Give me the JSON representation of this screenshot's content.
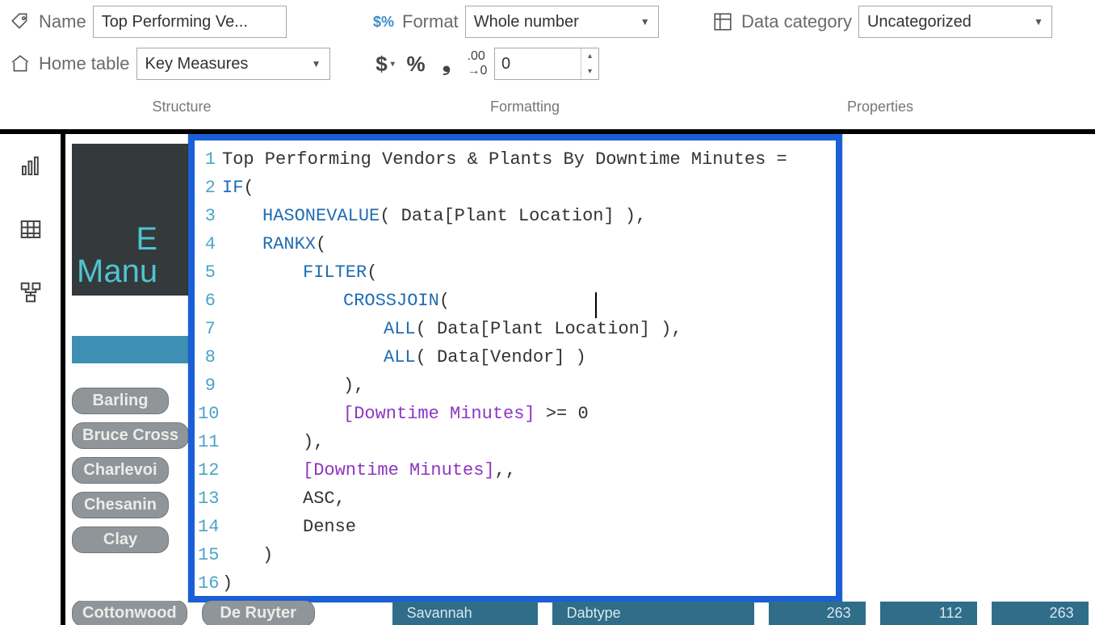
{
  "ribbon": {
    "name_label": "Name",
    "name_value": "Top Performing Ve...",
    "home_table_label": "Home table",
    "home_table_value": "Key Measures",
    "format_label": "Format",
    "format_value": "Whole number",
    "decimals_value": "0",
    "data_category_label": "Data category",
    "data_category_value": "Uncategorized",
    "structure_group": "Structure",
    "formatting_group": "Formatting",
    "properties_group": "Properties"
  },
  "slicers": {
    "items": [
      "Barling",
      "Bruce Cross",
      "Charlevoi",
      "Chesanin",
      "Clay"
    ],
    "bottom": [
      "Cottonwood",
      "De Ruyter"
    ]
  },
  "dark_text_line1": "E",
  "dark_text_line2": "Manu",
  "table_row": {
    "c0": "Savannah",
    "c1": "Dabtype",
    "c2": "263",
    "c3": "112",
    "c4": "263"
  },
  "formula": {
    "lines": [
      {
        "n": "1",
        "indent": 0,
        "parts": [
          {
            "t": "txt",
            "v": "Top Performing Vendors & Plants By Downtime Minutes ="
          }
        ]
      },
      {
        "n": "2",
        "indent": 0,
        "parts": [
          {
            "t": "kw",
            "v": "IF"
          },
          {
            "t": "txt",
            "v": "("
          }
        ]
      },
      {
        "n": "3",
        "indent": 1,
        "parts": [
          {
            "t": "kw",
            "v": "HASONEVALUE"
          },
          {
            "t": "txt",
            "v": "( Data[Plant Location] ),"
          }
        ]
      },
      {
        "n": "4",
        "indent": 1,
        "parts": [
          {
            "t": "kw",
            "v": "RANKX"
          },
          {
            "t": "txt",
            "v": "("
          }
        ]
      },
      {
        "n": "5",
        "indent": 2,
        "parts": [
          {
            "t": "kw",
            "v": "FILTER"
          },
          {
            "t": "txt",
            "v": "("
          }
        ]
      },
      {
        "n": "6",
        "indent": 3,
        "parts": [
          {
            "t": "kw",
            "v": "CROSSJOIN"
          },
          {
            "t": "txt",
            "v": "("
          }
        ]
      },
      {
        "n": "7",
        "indent": 4,
        "parts": [
          {
            "t": "kw",
            "v": "ALL"
          },
          {
            "t": "txt",
            "v": "( Data[Plant Location] ),"
          }
        ]
      },
      {
        "n": "8",
        "indent": 4,
        "parts": [
          {
            "t": "kw",
            "v": "ALL"
          },
          {
            "t": "txt",
            "v": "( Data[Vendor] )"
          }
        ]
      },
      {
        "n": "9",
        "indent": 3,
        "parts": [
          {
            "t": "txt",
            "v": "),"
          }
        ]
      },
      {
        "n": "10",
        "indent": 3,
        "parts": [
          {
            "t": "meas",
            "v": "[Downtime Minutes]"
          },
          {
            "t": "txt",
            "v": " >= 0"
          }
        ]
      },
      {
        "n": "11",
        "indent": 2,
        "parts": [
          {
            "t": "txt",
            "v": "),"
          }
        ]
      },
      {
        "n": "12",
        "indent": 2,
        "parts": [
          {
            "t": "meas",
            "v": "[Downtime Minutes]"
          },
          {
            "t": "txt",
            "v": ",,"
          }
        ]
      },
      {
        "n": "13",
        "indent": 2,
        "parts": [
          {
            "t": "txt",
            "v": "ASC,"
          }
        ]
      },
      {
        "n": "14",
        "indent": 2,
        "parts": [
          {
            "t": "txt",
            "v": "Dense"
          }
        ]
      },
      {
        "n": "15",
        "indent": 1,
        "parts": [
          {
            "t": "txt",
            "v": ")"
          }
        ]
      },
      {
        "n": "16",
        "indent": 0,
        "parts": [
          {
            "t": "txt",
            "v": ")"
          }
        ]
      }
    ]
  }
}
